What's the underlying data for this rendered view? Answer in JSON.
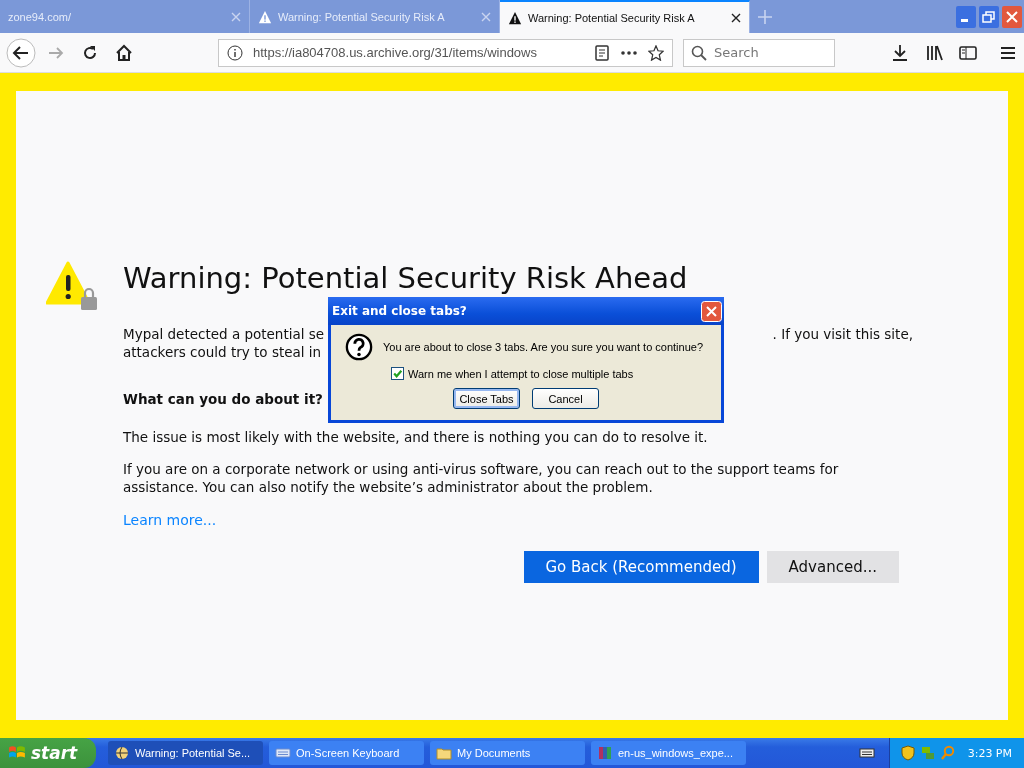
{
  "tabs": [
    {
      "title": "zone94.com/",
      "kind": "plain",
      "selected": false
    },
    {
      "title": "Warning: Potential Security Risk A",
      "kind": "warning",
      "selected": false
    },
    {
      "title": "Warning: Potential Security Risk A",
      "kind": "warning",
      "selected": true
    }
  ],
  "toolbar": {
    "url": "https://ia804708.us.archive.org/31/items/windows",
    "search_placeholder": "Search"
  },
  "page": {
    "title": "Warning: Potential Security Risk Ahead",
    "intro_lines": [
      [
        "Mypal detected a potential se",
        ". If you visit this site,"
      ],
      [
        "attackers could try to steal in"
      ]
    ],
    "heading": "What can you do about it?",
    "paragraphs": [
      "The issue is most likely with the website, and there is nothing you can do to resolve it.",
      "If you are on a corporate network or using anti-virus software, you can reach out to the support teams for assistance. You can also notify the website’s administrator about the problem."
    ],
    "link": "Learn more...",
    "buttons": [
      {
        "label": "Go Back (Recommended)",
        "kind": "primary"
      },
      {
        "label": "Advanced...",
        "kind": "secondary"
      }
    ]
  },
  "dialog": {
    "title": "Exit and close tabs?",
    "message": "You are about to close 3 tabs. Are you sure you want to continue?",
    "checkbox": {
      "label": "Warn me when I attempt to close multiple tabs",
      "checked": true
    },
    "buttons": [
      {
        "label": "Close Tabs",
        "focused": true
      },
      {
        "label": "Cancel",
        "focused": false
      }
    ]
  },
  "taskbar": {
    "start": "start",
    "items": [
      {
        "label": "Warning: Potential Se...",
        "kind": "browser",
        "selected": true
      },
      {
        "label": "On-Screen Keyboard",
        "kind": "keyboard",
        "selected": false
      },
      {
        "label": "My Documents",
        "kind": "folder",
        "selected": false
      },
      {
        "label": "en-us_windows_expe...",
        "kind": "archive",
        "selected": false
      }
    ],
    "clock": "3:23 PM"
  }
}
